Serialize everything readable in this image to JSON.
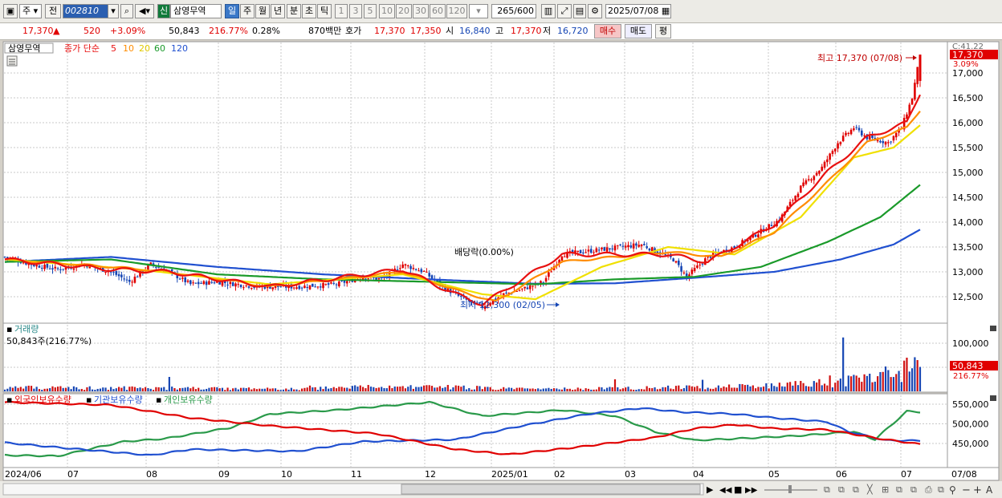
{
  "toolbar": {
    "stock_type": "주",
    "prev_label": "전",
    "code": "002810",
    "name_badge": "신",
    "stock_name": "삼영무역",
    "periods": [
      "일",
      "주",
      "월",
      "년",
      "분",
      "초",
      "틱"
    ],
    "minute_values": [
      "1",
      "3",
      "5",
      "10",
      "20",
      "30",
      "60",
      "120"
    ],
    "count": "265",
    "count_total": "/600",
    "date": "2025/07/08"
  },
  "quote": {
    "price": "17,370",
    "up_arrow": "▲",
    "change": "520",
    "change_pct": "+3.09%",
    "volume": "50,843",
    "volume_ratio": "216.77%",
    "turnover": "0.28%",
    "amount": "870백만",
    "ask_label": "호가",
    "ask": "17,370",
    "bid": "17,350",
    "open_label": "시",
    "open": "16,840",
    "high_label": "고",
    "high": "17,370",
    "low_label": "저",
    "low": "16,720",
    "buy_label": "매수",
    "sell_label": "매도",
    "eval_label": "평"
  },
  "price_panel": {
    "stock_label": "삼영무역",
    "ma_label": "종가 단순",
    "ma_periods": [
      "5",
      "10",
      "20",
      "60",
      "120"
    ],
    "ma_colors": [
      "#e81010",
      "#ff8c00",
      "#f0e000",
      "#1a9a2a",
      "#2050d0"
    ],
    "annot_high": "최고 17,370 (07/08)",
    "annot_low": "최저 12,300 (02/05)",
    "annot_dividend": "배당락(0.00%)",
    "corner_label": "C:41.22",
    "current_price": "17,370",
    "current_pct": "3.09%"
  },
  "volume_panel": {
    "title": "거래량",
    "value_label": "50,843주(216.77%)",
    "current_value": "50,843",
    "current_pct": "216.77%"
  },
  "holdings_panel": {
    "legends": [
      "외국인보유수량",
      "기관보유수량",
      "개인보유수량"
    ],
    "colors": [
      "#e00000",
      "#2050d0",
      "#2a9a4a"
    ]
  },
  "chart_data": {
    "type": "candlestick",
    "period": "daily",
    "x_axis_labels": [
      "2024/06",
      "07",
      "08",
      "09",
      "10",
      "11",
      "12",
      "2025/01",
      "02",
      "03",
      "04",
      "05",
      "06",
      "07",
      "07/08"
    ],
    "price_axis_ticks": [
      12500,
      13000,
      13500,
      14000,
      14500,
      15000,
      15500,
      16000,
      16500,
      17000
    ],
    "volume_axis_ticks": [
      50000,
      100000
    ],
    "holdings_axis_ticks": [
      450000,
      500000,
      550000
    ],
    "price_keypoints": [
      [
        0,
        13300
      ],
      [
        10,
        13150
      ],
      [
        20,
        13050
      ],
      [
        30,
        13150
      ],
      [
        40,
        13000
      ],
      [
        47,
        12800
      ],
      [
        55,
        13150
      ],
      [
        62,
        13000
      ],
      [
        70,
        12750
      ],
      [
        80,
        12800
      ],
      [
        95,
        12700
      ],
      [
        110,
        12700
      ],
      [
        125,
        12750
      ],
      [
        135,
        12900
      ],
      [
        142,
        12850
      ],
      [
        150,
        13150
      ],
      [
        158,
        13000
      ],
      [
        165,
        12700
      ],
      [
        173,
        12450
      ],
      [
        180,
        12300
      ],
      [
        188,
        12550
      ],
      [
        195,
        12650
      ],
      [
        203,
        12800
      ],
      [
        210,
        13350
      ],
      [
        225,
        13450
      ],
      [
        240,
        13550
      ],
      [
        252,
        13250
      ],
      [
        257,
        12900
      ],
      [
        265,
        13300
      ],
      [
        275,
        13500
      ],
      [
        283,
        13750
      ],
      [
        292,
        14050
      ],
      [
        300,
        14700
      ],
      [
        308,
        15100
      ],
      [
        314,
        15600
      ],
      [
        320,
        15900
      ],
      [
        325,
        15700
      ],
      [
        333,
        15600
      ],
      [
        338,
        15900
      ],
      [
        342,
        16500
      ],
      [
        345,
        17370
      ]
    ],
    "ma_series": {
      "ma5": [
        [
          0,
          13250
        ],
        [
          40,
          13050
        ],
        [
          62,
          13000
        ],
        [
          100,
          12700
        ],
        [
          150,
          13050
        ],
        [
          170,
          12550
        ],
        [
          180,
          12350
        ],
        [
          210,
          13350
        ],
        [
          250,
          13350
        ],
        [
          265,
          13200
        ],
        [
          290,
          13950
        ],
        [
          310,
          15000
        ],
        [
          325,
          15700
        ],
        [
          340,
          16000
        ],
        [
          345,
          16600
        ]
      ],
      "ma10": [
        [
          0,
          13250
        ],
        [
          40,
          13100
        ],
        [
          62,
          13000
        ],
        [
          100,
          12700
        ],
        [
          150,
          13000
        ],
        [
          172,
          12600
        ],
        [
          185,
          12400
        ],
        [
          210,
          13200
        ],
        [
          250,
          13400
        ],
        [
          270,
          13300
        ],
        [
          290,
          13800
        ],
        [
          310,
          14800
        ],
        [
          325,
          15600
        ],
        [
          340,
          15900
        ],
        [
          345,
          16250
        ]
      ],
      "ma20": [
        [
          0,
          13250
        ],
        [
          50,
          13050
        ],
        [
          100,
          12750
        ],
        [
          150,
          12950
        ],
        [
          180,
          12550
        ],
        [
          200,
          12450
        ],
        [
          225,
          13100
        ],
        [
          250,
          13500
        ],
        [
          275,
          13350
        ],
        [
          300,
          14100
        ],
        [
          320,
          15300
        ],
        [
          335,
          15500
        ],
        [
          345,
          15950
        ]
      ],
      "ma60": [
        [
          0,
          13200
        ],
        [
          40,
          13250
        ],
        [
          80,
          12950
        ],
        [
          120,
          12850
        ],
        [
          160,
          12800
        ],
        [
          200,
          12750
        ],
        [
          230,
          12850
        ],
        [
          260,
          12900
        ],
        [
          285,
          13100
        ],
        [
          310,
          13600
        ],
        [
          330,
          14100
        ],
        [
          345,
          14750
        ]
      ],
      "ma120": [
        [
          0,
          13200
        ],
        [
          40,
          13300
        ],
        [
          80,
          13100
        ],
        [
          120,
          12950
        ],
        [
          160,
          12850
        ],
        [
          200,
          12760
        ],
        [
          230,
          12770
        ],
        [
          265,
          12900
        ],
        [
          290,
          13000
        ],
        [
          315,
          13250
        ],
        [
          335,
          13550
        ],
        [
          345,
          13850
        ]
      ]
    },
    "volume_keypoints": [
      [
        0,
        8000
      ],
      [
        60,
        7000
      ],
      [
        110,
        5000
      ],
      [
        140,
        10000
      ],
      [
        170,
        9000
      ],
      [
        200,
        4500
      ],
      [
        230,
        7000
      ],
      [
        260,
        9000
      ],
      [
        290,
        12000
      ],
      [
        310,
        19000
      ],
      [
        325,
        30000
      ],
      [
        345,
        50843
      ]
    ],
    "volume_spikes": [
      [
        62,
        30000
      ],
      [
        115,
        12000
      ],
      [
        173,
        12000
      ],
      [
        230,
        25000
      ],
      [
        263,
        24000
      ],
      [
        311,
        33000
      ],
      [
        316,
        112000
      ],
      [
        330,
        40000
      ],
      [
        340,
        70000
      ]
    ],
    "holdings": {
      "foreign": [
        [
          0,
          555000
        ],
        [
          40,
          548000
        ],
        [
          70,
          515000
        ],
        [
          100,
          495000
        ],
        [
          140,
          475000
        ],
        [
          170,
          435000
        ],
        [
          190,
          422000
        ],
        [
          215,
          440000
        ],
        [
          245,
          465000
        ],
        [
          260,
          488000
        ],
        [
          275,
          498000
        ],
        [
          290,
          488000
        ],
        [
          310,
          485000
        ],
        [
          330,
          462000
        ],
        [
          345,
          448000
        ]
      ],
      "institution": [
        [
          0,
          452000
        ],
        [
          20,
          440000
        ],
        [
          55,
          420000
        ],
        [
          70,
          435000
        ],
        [
          110,
          430000
        ],
        [
          135,
          455000
        ],
        [
          170,
          460000
        ],
        [
          195,
          495000
        ],
        [
          220,
          525000
        ],
        [
          240,
          540000
        ],
        [
          255,
          530000
        ],
        [
          275,
          525000
        ],
        [
          290,
          515000
        ],
        [
          310,
          505000
        ],
        [
          318,
          480000
        ],
        [
          332,
          458000
        ],
        [
          345,
          457000
        ]
      ],
      "individual": [
        [
          0,
          420000
        ],
        [
          20,
          418000
        ],
        [
          45,
          455000
        ],
        [
          60,
          462000
        ],
        [
          85,
          490000
        ],
        [
          100,
          525000
        ],
        [
          125,
          535000
        ],
        [
          160,
          555000
        ],
        [
          180,
          520000
        ],
        [
          210,
          535000
        ],
        [
          230,
          520000
        ],
        [
          245,
          480000
        ],
        [
          260,
          458000
        ],
        [
          275,
          462000
        ],
        [
          300,
          470000
        ],
        [
          320,
          480000
        ],
        [
          328,
          460000
        ],
        [
          340,
          532000
        ],
        [
          345,
          530000
        ]
      ]
    }
  }
}
